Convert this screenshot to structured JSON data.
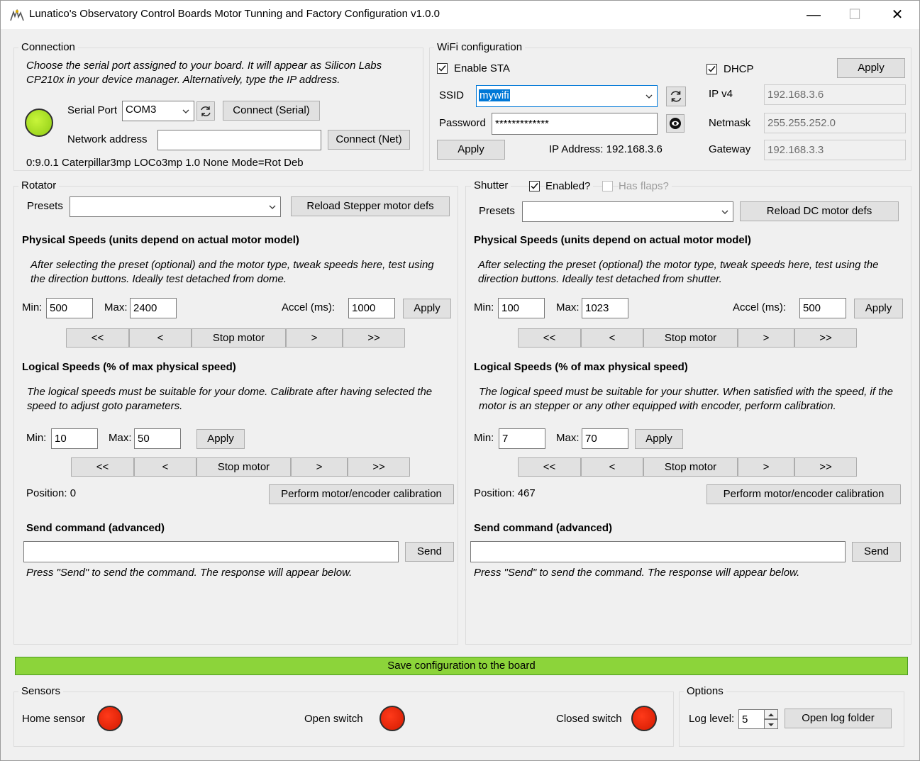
{
  "window": {
    "title": "Lunatico's Observatory Control Boards Motor Tunning and Factory Configuration v1.0.0",
    "minimize": "—",
    "maximize": "☐",
    "close": "✕"
  },
  "connection": {
    "group_label": "Connection",
    "hint": "Choose the serial port assigned to your board. It will appear as Silicon Labs CP210x in your device manager. Alternatively, type the IP address.",
    "serial_port_label": "Serial Port",
    "serial_port_value": "COM3",
    "connect_serial_label": "Connect (Serial)",
    "network_address_label": "Network address",
    "network_address_value": "",
    "connect_net_label": "Connect (Net)",
    "status_text": "0:9.0.1 Caterpillar3mp LOCo3mp 1.0 None Mode=Rot Deb",
    "status_led_color": "#a6e022"
  },
  "wifi": {
    "group_label": "WiFi configuration",
    "enable_sta_label": "Enable STA",
    "enable_sta_checked": true,
    "ssid_label": "SSID",
    "ssid_value": "mywifi",
    "password_label": "Password",
    "password_value": "*************",
    "apply_label": "Apply",
    "ip_address_text": "IP Address: 192.168.3.6",
    "dhcp_label": "DHCP",
    "dhcp_checked": true,
    "apply_top_label": "Apply",
    "ipv4_label": "IP v4",
    "ipv4_value": "192.168.3.6",
    "netmask_label": "Netmask",
    "netmask_value": "255.255.252.0",
    "gateway_label": "Gateway",
    "gateway_value": "192.168.3.3"
  },
  "rotator": {
    "group_label": "Rotator",
    "presets_label": "Presets",
    "presets_value": "",
    "reload_label": "Reload Stepper motor defs",
    "physical_title": "Physical Speeds (units depend on actual motor model)",
    "physical_hint": "After selecting the preset (optional) and the motor type, tweak speeds here, test using the direction buttons. Ideally test detached from dome.",
    "min_label": "Min:",
    "min_value": "500",
    "max_label": "Max:",
    "max_value": "2400",
    "accel_label": "Accel (ms):",
    "accel_value": "1000",
    "apply_label": "Apply",
    "phys_buttons": [
      "<<",
      "<",
      "Stop motor",
      ">",
      ">>"
    ],
    "logical_title": "Logical Speeds (% of max physical speed)",
    "logical_hint": "The logical speeds must be suitable for your dome. Calibrate after having selected the speed to adjust goto parameters.",
    "lmin_label": "Min:",
    "lmin_value": "10",
    "lmax_label": "Max:",
    "lmax_value": "50",
    "lapply_label": "Apply",
    "log_buttons": [
      "<<",
      "<",
      "Stop motor",
      ">",
      ">>"
    ],
    "position_text": "Position: 0",
    "calibrate_label": "Perform motor/encoder calibration",
    "send_title": "Send command (advanced)",
    "send_value": "",
    "send_label": "Send",
    "send_hint": "Press \"Send\" to send the command. The response will appear below."
  },
  "shutter": {
    "group_label": "Shutter",
    "enabled_label": "Enabled?",
    "enabled_checked": true,
    "has_flaps_label": "Has flaps?",
    "has_flaps_checked": false,
    "presets_label": "Presets",
    "presets_value": "",
    "reload_label": "Reload DC motor defs",
    "physical_title": "Physical Speeds (units depend on actual motor model)",
    "physical_hint": "After selecting the preset (optional) the motor type, tweak speeds here, test using the direction buttons. Ideally test detached from shutter.",
    "min_label": "Min:",
    "min_value": "100",
    "max_label": "Max:",
    "max_value": "1023",
    "accel_label": "Accel (ms):",
    "accel_value": "500",
    "apply_label": "Apply",
    "phys_buttons": [
      "<<",
      "<",
      "Stop motor",
      ">",
      ">>"
    ],
    "logical_title": "Logical Speeds (% of max physical speed)",
    "logical_hint": "The logical speed must be suitable for your shutter. When satisfied with the speed, if the motor is an stepper or any other equipped with encoder, perform calibration.",
    "lmin_label": "Min:",
    "lmin_value": "7",
    "lmax_label": "Max:",
    "lmax_value": "70",
    "lapply_label": "Apply",
    "log_buttons": [
      "<<",
      "<",
      "Stop motor",
      ">",
      ">>"
    ],
    "position_text": "Position: 467",
    "calibrate_label": "Perform motor/encoder calibration",
    "send_title": "Send command (advanced)",
    "send_value": "",
    "send_label": "Send",
    "send_hint": "Press \"Send\" to send the command. The response will appear below."
  },
  "save": {
    "label": "Save configuration to the board",
    "color": "#8cd43a"
  },
  "sensors": {
    "group_label": "Sensors",
    "home_label": "Home sensor",
    "open_label": "Open switch",
    "closed_label": "Closed switch",
    "led_color": "#e11f00"
  },
  "options": {
    "group_label": "Options",
    "log_level_label": "Log level:",
    "log_level_value": "5",
    "open_log_label": "Open log folder"
  },
  "icons": {
    "refresh": "refresh-icon",
    "eye": "eye-icon",
    "dropdown": "chevron-down-icon",
    "check": "checkmark-icon"
  }
}
